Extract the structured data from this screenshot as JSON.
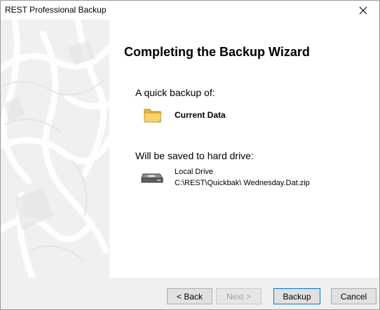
{
  "window": {
    "title": "REST Professional Backup",
    "close_icon": "close-icon"
  },
  "wizard": {
    "heading": "Completing the Backup Wizard",
    "backup_label": "A quick backup of:",
    "source": {
      "icon": "folder-icon",
      "name": "Current Data"
    },
    "saved_label": "Will be saved to hard drive:",
    "destination": {
      "icon": "hard-drive-icon",
      "name": "Local Drive",
      "path": "C:\\REST\\Quickbak\\ Wednesday.Dat.zip"
    }
  },
  "buttons": {
    "back": "< Back",
    "next": "Next >",
    "backup": "Backup",
    "cancel": "Cancel"
  },
  "colors": {
    "panel_bg": "#f0f0f0",
    "default_button_border": "#0078d7",
    "folder_yellow": "#f6d36b"
  }
}
